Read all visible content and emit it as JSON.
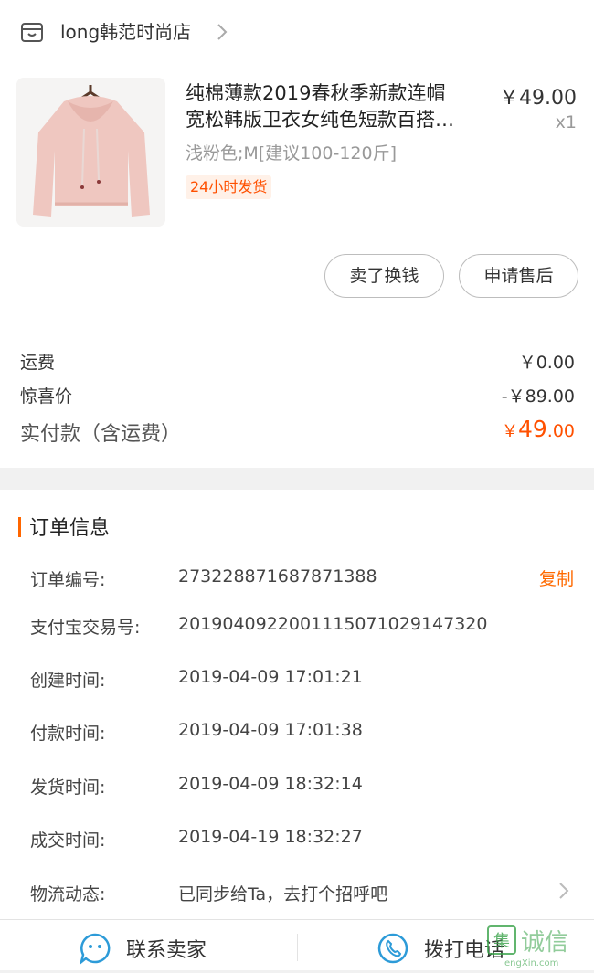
{
  "shop": {
    "name": "long韩范时尚店",
    "icon": "store-icon"
  },
  "product": {
    "title_line1": "纯棉薄款2019春秋季新款连帽",
    "title_line2": "宽松韩版卫衣女纯色短款百搭…",
    "price": "￥49.00",
    "quantity": "x1",
    "sku": "浅粉色;M[建议100-120斤]",
    "badge": "24小时发货"
  },
  "actions": {
    "sell": "卖了换钱",
    "aftersale": "申请售后"
  },
  "summary": {
    "shipping_label": "运费",
    "shipping_value": "￥0.00",
    "discount_label": "惊喜价",
    "discount_value": "-￥89.00",
    "total_label": "实付款（含运费）",
    "total_currency": "￥",
    "total_int": "49",
    "total_dec": ".00"
  },
  "order_info": {
    "title": "订单信息",
    "copy_label": "复制",
    "rows": [
      {
        "label": "订单编号:",
        "value": "273228871687871388"
      },
      {
        "label": "支付宝交易号:",
        "value": "2019040922001115071029147320"
      },
      {
        "label": "创建时间:",
        "value": "2019-04-09 17:01:21"
      },
      {
        "label": "付款时间:",
        "value": "2019-04-09 17:01:38"
      },
      {
        "label": "发货时间:",
        "value": "2019-04-09 18:32:14"
      },
      {
        "label": "成交时间:",
        "value": "2019-04-19 18:32:27"
      },
      {
        "label": "物流动态:",
        "value": "已同步给Ta，去打个招呼吧"
      }
    ]
  },
  "bottom_bar": {
    "contact_seller": "联系卖家",
    "call_phone": "拨打电话"
  },
  "watermark": {
    "text": "诚信",
    "url_text": "engXin.com"
  },
  "colors": {
    "accent": "#ff5000",
    "badge_bg": "#fff1e8",
    "icon_blue": "#2d9bd8"
  }
}
